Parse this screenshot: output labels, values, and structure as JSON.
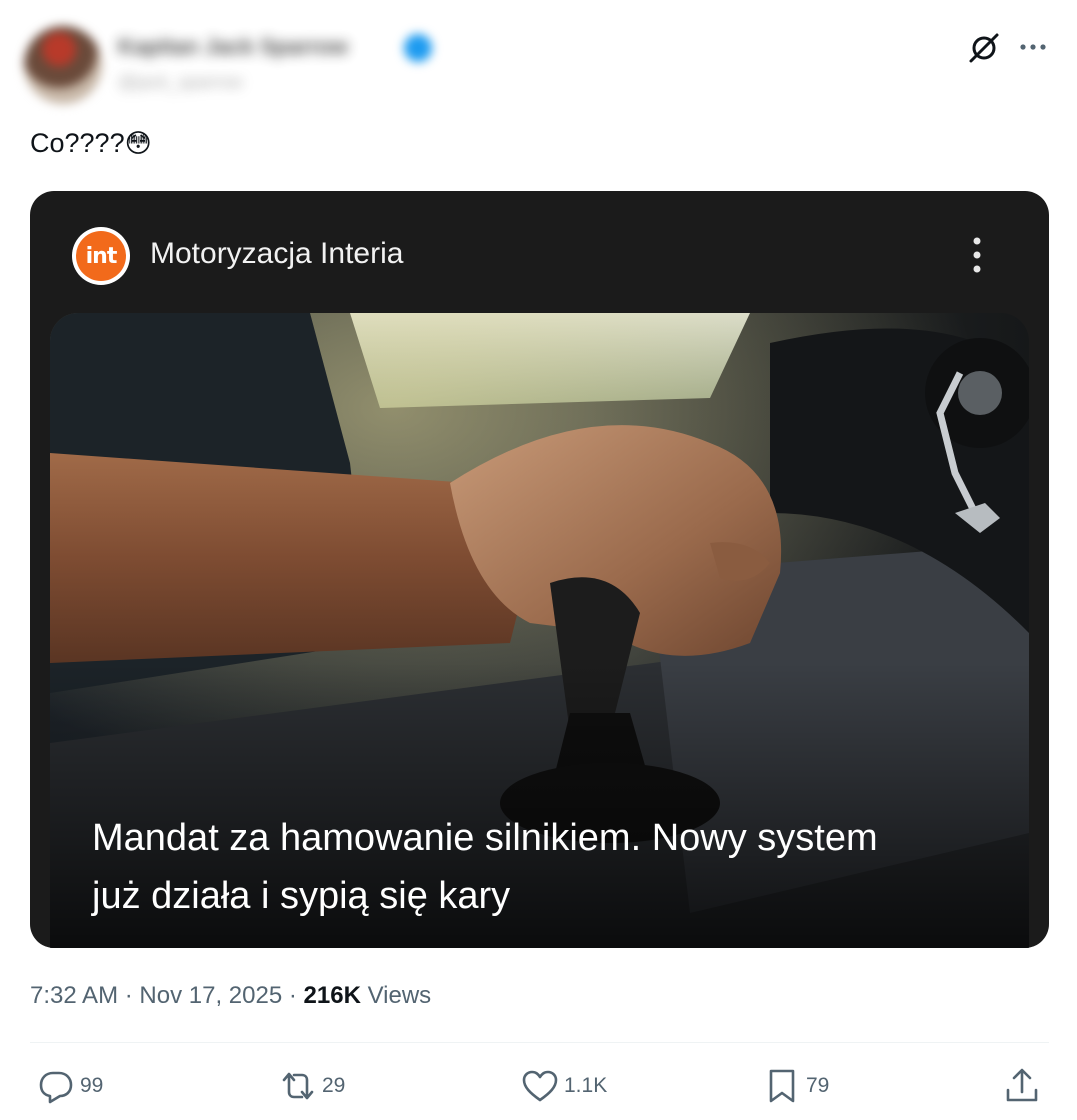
{
  "author": {
    "name": "Kapitan Jack Sparrow",
    "handle": "@jack_sparrow"
  },
  "tweet": {
    "text": "Co????",
    "emoji": "😳"
  },
  "card": {
    "source_name": "Motoryzacja Interia",
    "logo_text": "int",
    "headline_line1": "Mandat za hamowanie silnikiem. Nowy system",
    "headline_line2": "już działa i sypią się kary"
  },
  "meta": {
    "time": "7:32 AM",
    "date": "Nov 17, 2025",
    "views_count": "216K",
    "views_label": "Views",
    "sep": "·"
  },
  "actions": {
    "replies": "99",
    "reposts": "29",
    "likes": "1.1K",
    "bookmarks": "79"
  },
  "icons": [
    "grok-icon",
    "more-icon",
    "kebab-menu-icon",
    "reply-icon",
    "retweet-icon",
    "like-icon",
    "bookmark-icon",
    "share-icon"
  ],
  "colors": {
    "text": "#0f1419",
    "muted": "#536471",
    "verified": "#1d9bf0",
    "card_bg": "#1b1b1b",
    "logo_orange": "#f26a1b"
  }
}
